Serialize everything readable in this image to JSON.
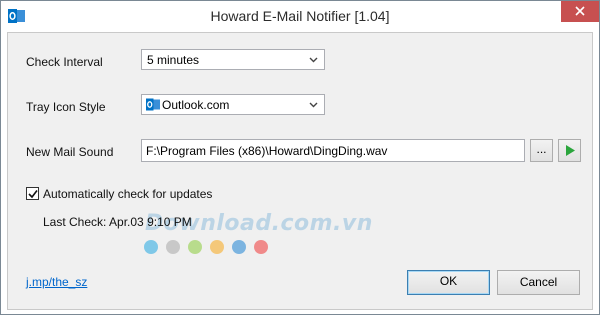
{
  "window": {
    "title": "Howard E-Mail Notifier [1.04]"
  },
  "form": {
    "check_interval_label": "Check Interval",
    "check_interval_value": "5 minutes",
    "tray_icon_label": "Tray Icon Style",
    "tray_icon_value": "Outlook.com",
    "new_mail_sound_label": "New Mail Sound",
    "new_mail_sound_value": "F:\\Program Files (x86)\\Howard\\DingDing.wav",
    "browse_label": "...",
    "auto_update_label": "Automatically check for updates",
    "auto_update_checked": true,
    "last_check_text": "Last Check: Apr.03 9:10 PM"
  },
  "footer": {
    "link_text": "j.mp/the_sz",
    "ok_label": "OK",
    "cancel_label": "Cancel"
  },
  "watermark": {
    "text": "Download.com.vn",
    "dot_colors": [
      "#7fc8e8",
      "#c8c8c8",
      "#b8dc8c",
      "#f4c87a",
      "#7cb4e0",
      "#f08a8a"
    ]
  },
  "colors": {
    "outlook_blue": "#0072c6",
    "play_green": "#2aa53c",
    "close_red": "#c75050"
  }
}
